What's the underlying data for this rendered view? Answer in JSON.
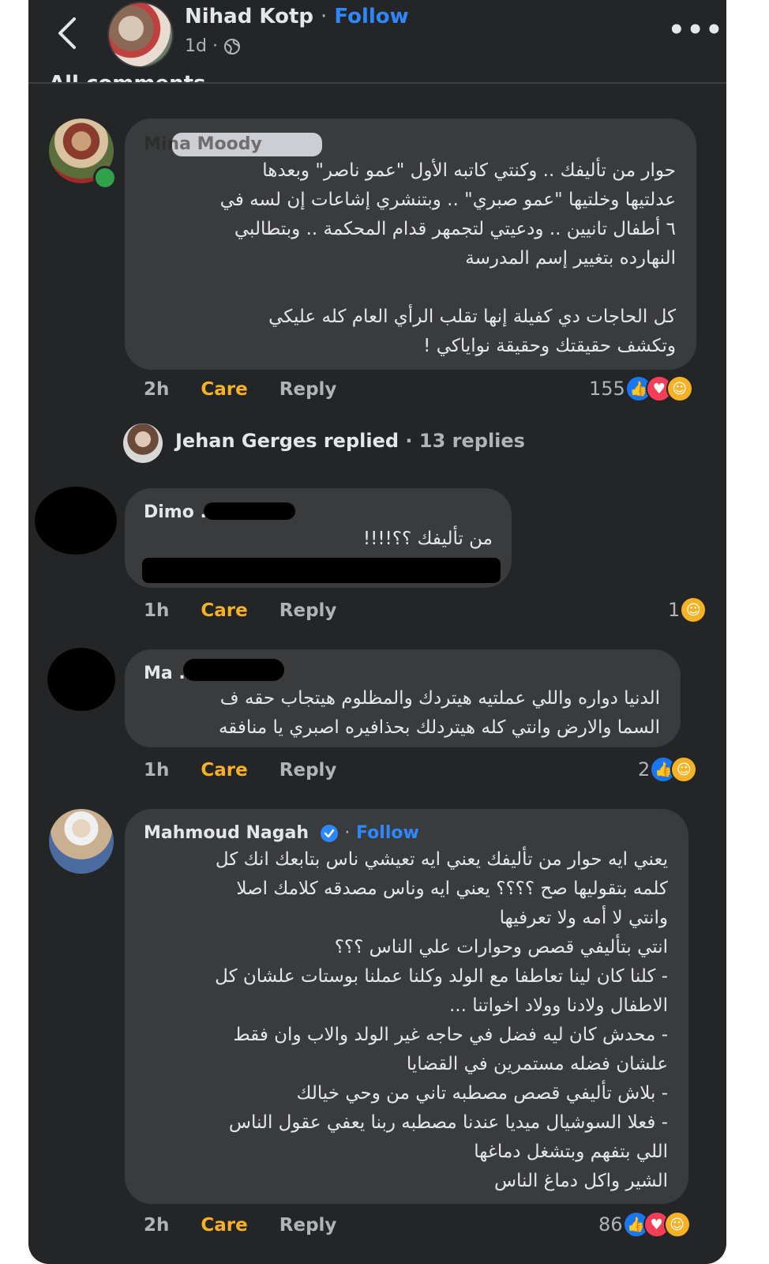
{
  "header": {
    "name": "Nihad Kotp",
    "separator": "·",
    "follow": "Follow",
    "time": "1d",
    "meta_separator": "·",
    "section_label": "All comments"
  },
  "comments": [
    {
      "author": "Mina Moody",
      "lines": [
        "حوار من تأليفك .. وكنتي كاتبه الأول \"عمو ناصر\" وبعدها",
        "عدلتيها وخلتيها \"عمو صبري\" .. وبتنشري إشاعات إن لسه في",
        "٦ أطفال تانيين .. ودعيتي لتجمهر قدام المحكمة .. وبتطالبي",
        "النهارده بتغيير إسم المدرسة",
        "",
        "كل الحاجات دي كفيلة إنها تقلب الرأي العام كله عليكي",
        "وتكشف حقيقتك وحقيقة نواياكي !"
      ],
      "time": "2h",
      "care": "Care",
      "reply": "Reply",
      "reaction_count": "155",
      "reactions": [
        "like",
        "love",
        "care"
      ]
    },
    {
      "author": "Dimo ..",
      "lines": [
        "من تأليفك ؟؟!!!!"
      ],
      "time": "1h",
      "care": "Care",
      "reply": "Reply",
      "reaction_count": "1",
      "reactions": [
        "care"
      ]
    },
    {
      "author": "Ma .",
      "lines": [
        "الدنيا دواره واللي عملتيه هيتردك والمظلوم هيتجاب حقه ف",
        "السما والارض وانتي كله هيتردلك بحذافيره اصبري يا منافقه"
      ],
      "time": "1h",
      "care": "Care",
      "reply": "Reply",
      "reaction_count": "2",
      "reactions": [
        "like",
        "care"
      ]
    },
    {
      "author": "Mahmoud Nagah",
      "follow": "Follow",
      "separator": "·",
      "lines": [
        "يعني ايه حوار من تأليفك يعني ايه تعيشي ناس بتابعك انك كل",
        "كلمه بتقوليها صح ؟؟؟؟ يعني ايه وناس مصدقه كلامك اصلا",
        "وانتي لا أمه ولا تعرفيها",
        "انتي بتأليفي قصص وحوارات علي الناس ؟؟؟",
        "- كلنا كان لينا تعاطفا مع الولد وكلنا عملنا بوستات علشان كل",
        "الاطفال ولادنا وولاد اخواتنا ...",
        "- محدش كان ليه فضل في حاجه غير الولد والاب وان فقط",
        "علشان فضله مستمرين في القضايا",
        "- بلاش تأليفي قصص مصطبه تاني من وحي خيالك",
        "- فعلا السوشيال ميديا عندنا مصطبه ربنا يعفي عقول الناس",
        "اللي بتفهم وبتشغل دماغها",
        "الشير واكل دماغ الناس"
      ],
      "time": "2h",
      "care": "Care",
      "reply": "Reply",
      "reaction_count": "86",
      "reactions": [
        "like",
        "love",
        "care"
      ]
    }
  ],
  "replies_summary": {
    "name": "Jehan Gerges",
    "verb": "replied",
    "separator": "·",
    "count": "13 replies"
  },
  "colors": {
    "background": "#242526",
    "bubble": "#3a3b3c",
    "text": "#e4e6eb",
    "muted": "#b0b3b8",
    "follow": "#2d88ff",
    "care": "#f7b125",
    "like": "#1877f2",
    "love": "#f33e58",
    "online": "#31a24c"
  }
}
